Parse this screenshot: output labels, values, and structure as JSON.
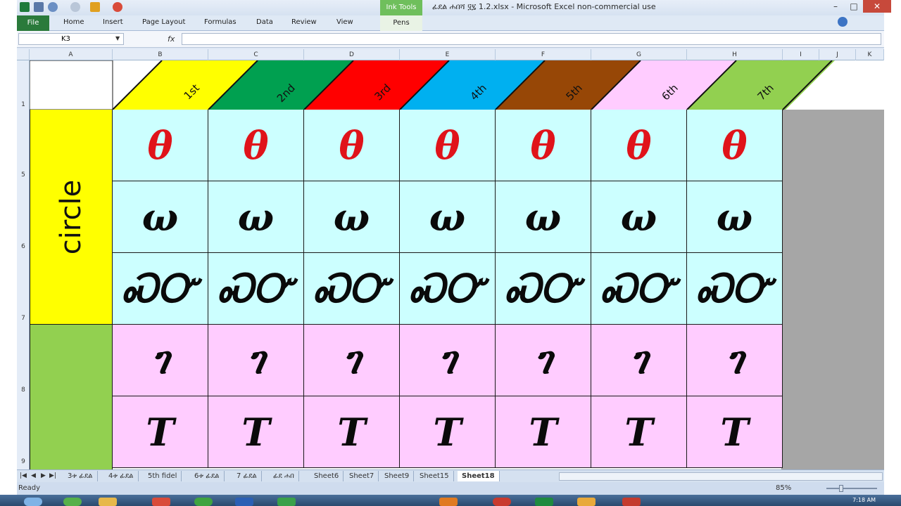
{
  "window": {
    "title": "ፊደል ሐበሻ ፶፯ 1.2.xlsx - Microsoft Excel non-commercial use",
    "context_tab": "Ink Tools",
    "context_subtab": "Pens"
  },
  "ribbon": {
    "tabs": [
      "File",
      "Home",
      "Insert",
      "Page Layout",
      "Formulas",
      "Data",
      "Review",
      "View"
    ]
  },
  "formula_bar": {
    "name_box": "K3",
    "fx": "fx",
    "formula": ""
  },
  "columns": [
    "A",
    "B",
    "C",
    "D",
    "E",
    "F",
    "G",
    "H",
    "I",
    "J",
    "K"
  ],
  "rows": [
    "1",
    "5",
    "6",
    "7",
    "8",
    "9"
  ],
  "orders": [
    {
      "label": "1st",
      "color": "#ffff00"
    },
    {
      "label": "2nd",
      "color": "#00a050"
    },
    {
      "label": "3rd",
      "color": "#ff0000"
    },
    {
      "label": "4th",
      "color": "#00b0f0"
    },
    {
      "label": "5th",
      "color": "#974706"
    },
    {
      "label": "6th",
      "color": "#ffccff"
    },
    {
      "label": "7th",
      "color": "#92d050"
    }
  ],
  "group_labels": {
    "circle": "circle"
  },
  "glyph_rows": [
    {
      "group": "circle",
      "bg": "#ccffff",
      "color": "#e0131a",
      "chars": [
        "θ",
        "θ",
        "θ",
        "θ",
        "θ",
        "θ",
        "θ"
      ]
    },
    {
      "group": "circle",
      "bg": "#ccffff",
      "color": "#0a0a0a",
      "chars": [
        "ω",
        "ω",
        "ω",
        "ω",
        "ω",
        "ω",
        "ω"
      ]
    },
    {
      "group": "circle",
      "bg": "#ccffff",
      "color": "#0a0a0a",
      "chars": [
        "ᏍᏅ",
        "ᏍᏅ",
        "ᏍᏅ",
        "ᏍᏅ",
        "ᏍᏅ",
        "ᏍᏅ",
        "ᏍᏅ"
      ]
    },
    {
      "group": "green",
      "bg": "#ffccff",
      "color": "#0a0a0a",
      "chars": [
        "ገ",
        "ገ",
        "ገ",
        "ገ",
        "ገ",
        "ገ",
        "ገ"
      ]
    },
    {
      "group": "green",
      "bg": "#ffccff",
      "color": "#0a0a0a",
      "chars": [
        "T",
        "T",
        "T",
        "T",
        "T",
        "T",
        "T"
      ]
    }
  ],
  "sheet_tabs": [
    {
      "label": "3ቱ ፊደል",
      "active": false
    },
    {
      "label": "4ቱ ፊደል",
      "active": false
    },
    {
      "label": "5th fidel",
      "active": false
    },
    {
      "label": "6ቱ ፊደል",
      "active": false
    },
    {
      "label": "7 ፊደል",
      "active": false
    },
    {
      "label": "ፊደ ሐበ",
      "active": false
    },
    {
      "label": "Sheet6",
      "active": false
    },
    {
      "label": "Sheet7",
      "active": false
    },
    {
      "label": "Sheet9",
      "active": false
    },
    {
      "label": "Sheet15",
      "active": false
    },
    {
      "label": "Sheet18",
      "active": true
    }
  ],
  "status": {
    "ready": "Ready",
    "zoom": "85%"
  },
  "taskbar": {
    "clock": "7:18 AM"
  }
}
